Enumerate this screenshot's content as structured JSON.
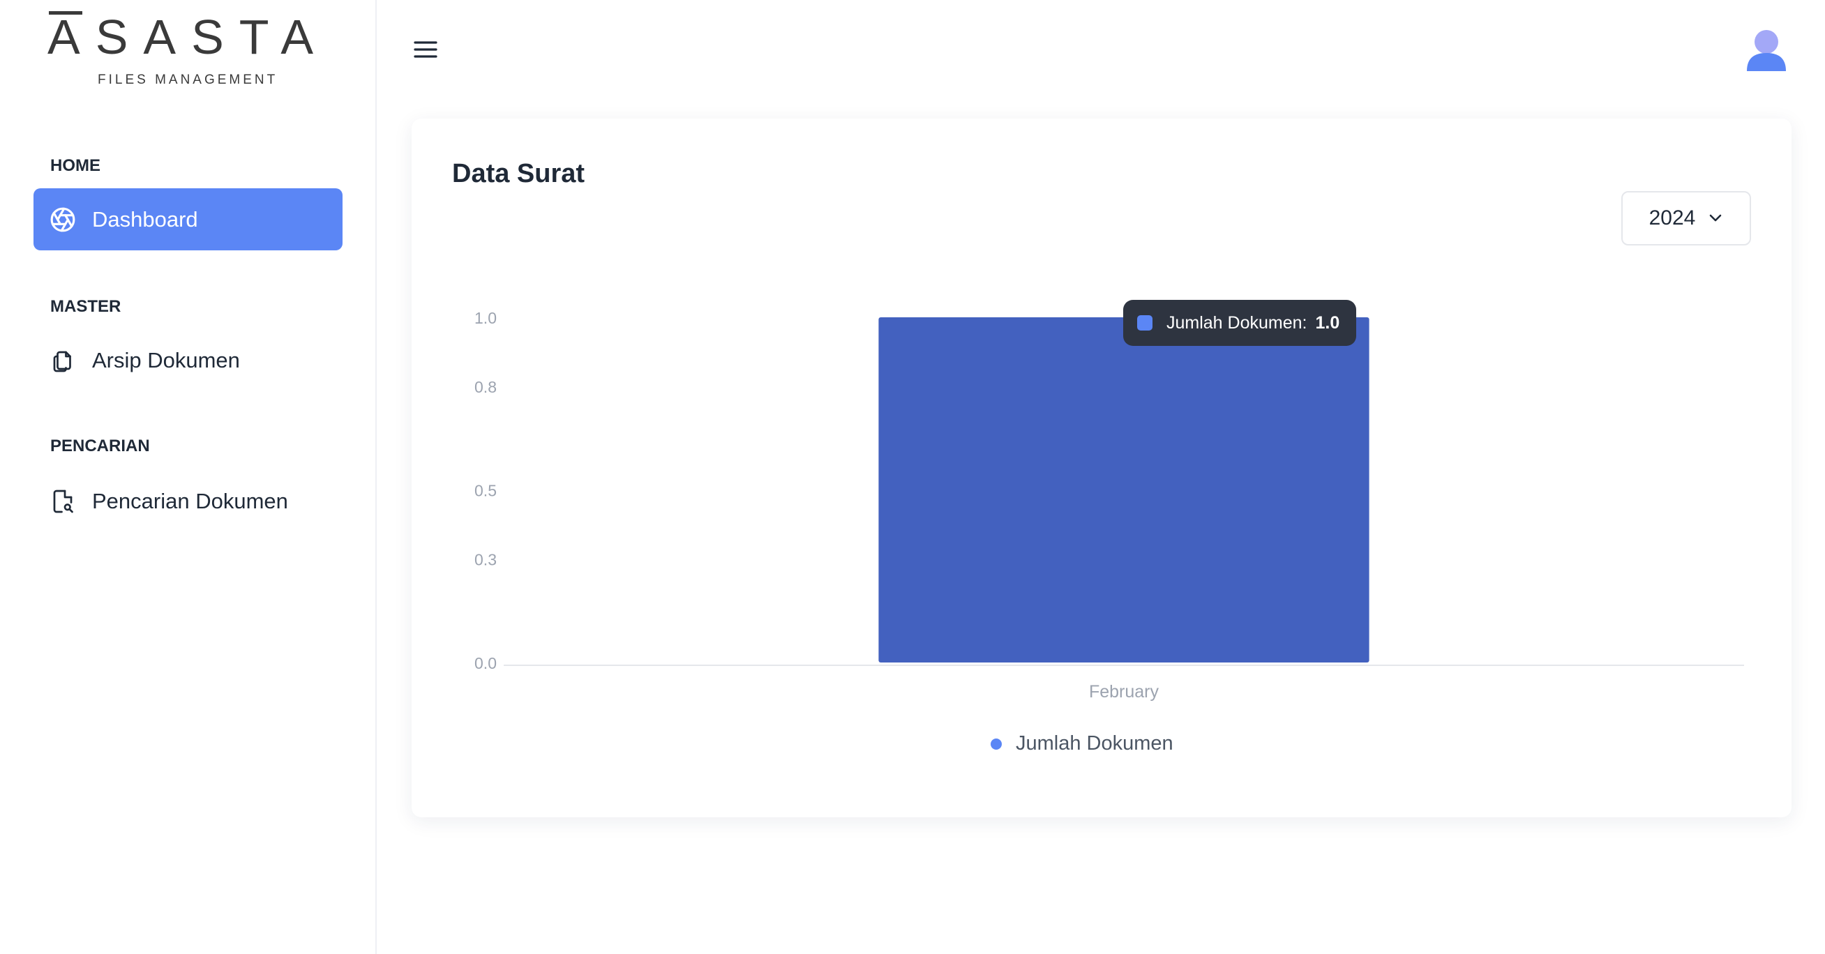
{
  "brand": {
    "name": "ASASTA",
    "subtitle": "FILES MANAGEMENT"
  },
  "sidebar": {
    "sections": [
      {
        "title": "HOME",
        "items": [
          {
            "label": "Dashboard",
            "icon": "dashboard-aperture-icon",
            "active": true
          }
        ]
      },
      {
        "title": "MASTER",
        "items": [
          {
            "label": "Arsip Dokumen",
            "icon": "copy-documents-icon",
            "active": false
          }
        ]
      },
      {
        "title": "PENCARIAN",
        "items": [
          {
            "label": "Pencarian Dokumen",
            "icon": "file-search-icon",
            "active": false
          }
        ]
      }
    ]
  },
  "header": {
    "menu_icon": "hamburger-icon",
    "avatar_icon": "user-avatar-icon"
  },
  "card": {
    "title": "Data Surat",
    "year_select": {
      "value": "2024"
    }
  },
  "tooltip": {
    "label": "Jumlah Dokumen:",
    "value": "1.0"
  },
  "colors": {
    "accent": "#5b86f5",
    "bar": "#4361bf",
    "tooltip_bg": "#2e3440"
  },
  "chart_data": {
    "type": "bar",
    "categories": [
      "February"
    ],
    "series": [
      {
        "name": "Jumlah Dokumen",
        "values": [
          1.0
        ]
      }
    ],
    "ylim": [
      0,
      1.0
    ],
    "yticks": [
      "0.0",
      "0.3",
      "0.5",
      "0.8",
      "1.0"
    ],
    "legend": "bottom-center",
    "grid": false
  }
}
